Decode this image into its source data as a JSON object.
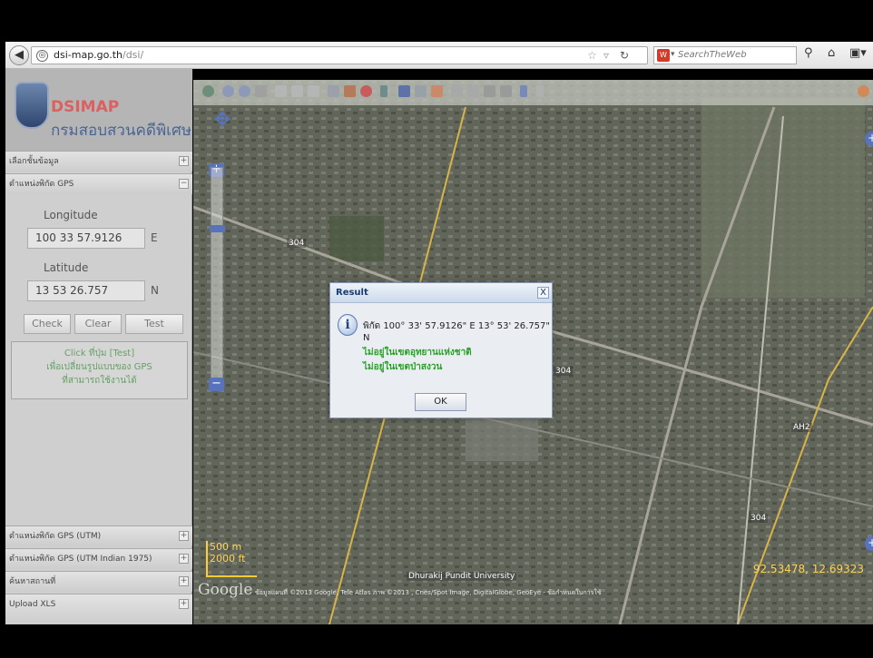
{
  "browser": {
    "url_host": "dsi-map.go.th",
    "url_path": "/dsi/",
    "search_placeholder": "SearchTheWeb"
  },
  "sidebar": {
    "logo_title": "DSIMAP",
    "logo_subtitle": "กรมสอบสวนคดีพิเศษ",
    "section_layers": "เลือกชั้นข้อมูล",
    "section_gps": "ตำแหน่งพิกัด GPS",
    "longitude_label": "Longitude",
    "longitude_value": "100 33 57.9126",
    "longitude_unit": "E",
    "latitude_label": "Latitude",
    "latitude_value": "13 53 26.757",
    "latitude_unit": "N",
    "btn_check": "Check",
    "btn_clear": "Clear",
    "btn_test": "Test",
    "hint_line1": "Click ที่ปุ่ม [Test]",
    "hint_line2": "เพื่อเปลี่ยนรูปแบบของ GPS",
    "hint_line3": "ที่สามารถใช้งานได้",
    "section_utm": "ตำแหน่งพิกัด GPS (UTM)",
    "section_utm_indian": "ตำแหน่งพิกัด GPS (UTM Indian 1975)",
    "section_search_place": "ค้นหาสถานที่",
    "section_upload": "Upload XLS"
  },
  "map": {
    "scale_m": "500 m",
    "scale_ft": "2000 ft",
    "google": "Google",
    "attribution": "ข้อมูลแผนที่ ©2013 Google, Tele Atlas ภาพ ©2013 , Cnes/Spot Image, DigitalGlobe, GeoEye - ข้อกำหนดในการใช้",
    "coords": "92.53478, 12.69323",
    "road_304": "304",
    "road_ah2": "AH2",
    "label_dhurakij": "Dhurakij Pundit University"
  },
  "dialog": {
    "title": "Result",
    "close": "X",
    "coord_line": "พิกัด 100° 33' 57.9126\" E 13° 53' 26.757\" N",
    "line1": "ไม่อยู่ในเขตอุทยานแห่งชาติ",
    "line2": "ไม่อยู่ในเขตป่าสงวน",
    "ok": "OK"
  },
  "colors": {
    "accent": "#5872bc",
    "logo_red": "#dc6060",
    "status_green": "#28a028",
    "coords_yellow": "#ffd24a"
  }
}
